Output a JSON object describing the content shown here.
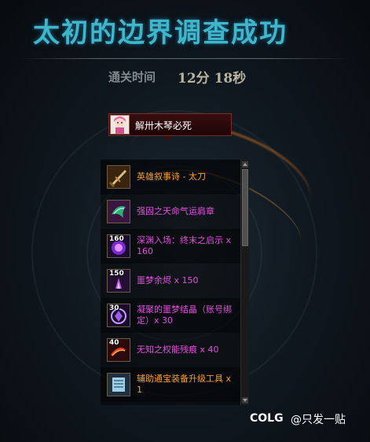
{
  "header": {
    "title": "太初的边界调查成功",
    "clear_time_label": "通关时间",
    "clear_time_value": "12分 18秒"
  },
  "player": {
    "name": "解卅木琴必死"
  },
  "reward_items": [
    {
      "name": "英雄叙事诗 - 太刀",
      "quantity": "",
      "rarity_color": "#ff9f29",
      "icon": "sword-icon"
    },
    {
      "name": "强固之天命气运肩章",
      "quantity": "",
      "rarity_color": "#e64ee0",
      "icon": "shoulder-icon"
    },
    {
      "name": "深渊入场：终末之启示 x 160",
      "quantity": "160",
      "rarity_color": "#e64ee0",
      "icon": "abyss-ticket-icon"
    },
    {
      "name": "噩梦余烬 x 150",
      "quantity": "150",
      "rarity_color": "#e64ee0",
      "icon": "ember-icon"
    },
    {
      "name": "凝聚的噩梦结晶（账号绑定）x 30",
      "quantity": "30",
      "rarity_color": "#e64ee0",
      "icon": "crystal-icon"
    },
    {
      "name": "无知之权能残痕 x 40",
      "quantity": "40",
      "rarity_color": "#e64ee0",
      "icon": "remnant-icon"
    },
    {
      "name": "辅助通宝装备升级工具 x 1",
      "quantity": "",
      "rarity_color": "#ff9f29",
      "icon": "upgrade-tool-icon"
    }
  ],
  "watermark": {
    "logo": "COLG",
    "text": "@只发一贴"
  }
}
